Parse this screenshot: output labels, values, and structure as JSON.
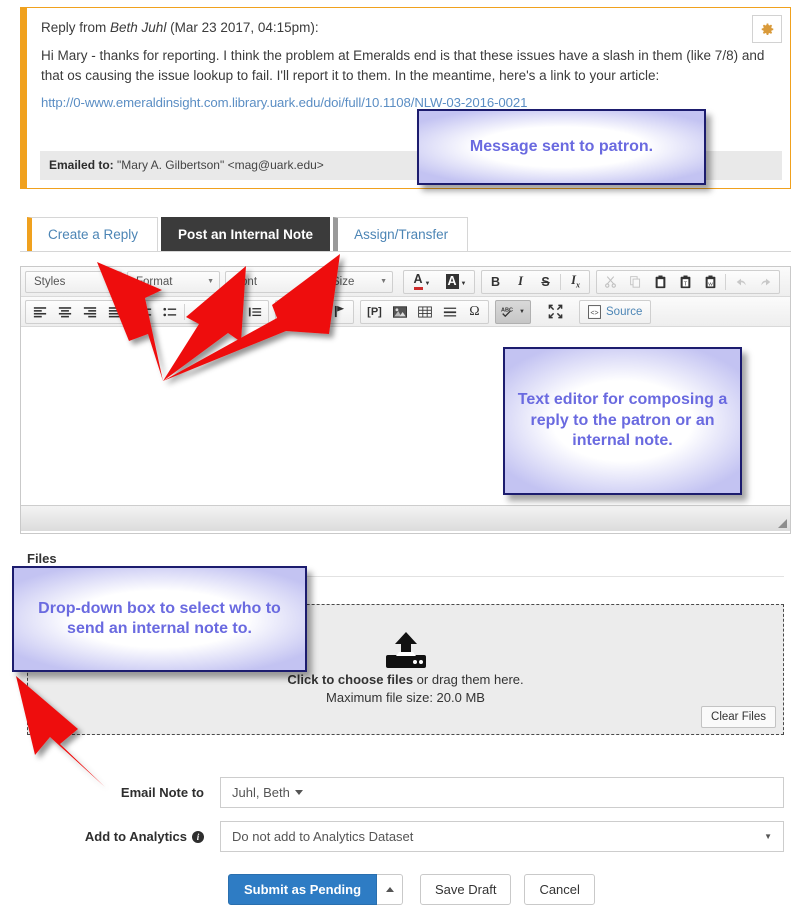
{
  "message": {
    "header_prefix": "Reply from ",
    "author": "Beth Juhl",
    "header_suffix": " (Mar 23 2017, 04:15pm):",
    "body": "Hi Mary - thanks for reporting.  I think the problem at Emeralds end is that these issues have a slash in them (like 7/8) and that os causing the issue lookup to fail.  I'll report it to them.  In the meantime, here's a link to your article:",
    "link": "http://0-www.emeraldinsight.com.library.uark.edu/doi/full/10.1108/NLW-03-2016-0021",
    "emailed_to_label": "Emailed to:",
    "emailed_to_value": " \"Mary A. Gilbertson\" <mag@uark.edu>",
    "gear_icon": "gear-icon"
  },
  "tabs": [
    {
      "label": "Create a Reply",
      "active": false,
      "accent": "#f0a11e"
    },
    {
      "label": "Post an Internal Note",
      "active": true,
      "accent": "#3b3b3b"
    },
    {
      "label": "Assign/Transfer",
      "active": false,
      "accent": "#9a9a9a"
    }
  ],
  "editor": {
    "combos": [
      {
        "label": "Styles",
        "name": "styles-dropdown"
      },
      {
        "label": "Format",
        "name": "format-dropdown"
      },
      {
        "label": "Font",
        "name": "font-dropdown"
      },
      {
        "label": "Size",
        "name": "size-dropdown"
      }
    ],
    "row1_icons": [
      "text-color-icon",
      "background-color-icon",
      "bold-icon",
      "italic-icon",
      "strikethrough-icon",
      "remove-format-icon",
      "cut-icon",
      "copy-icon",
      "paste-icon",
      "paste-text-icon",
      "paste-word-icon",
      "undo-icon",
      "redo-icon"
    ],
    "row2_icons": [
      "align-left-icon",
      "align-center-icon",
      "align-right-icon",
      "align-justify-icon",
      "numbered-list-icon",
      "bulleted-list-icon",
      "outdent-icon",
      "indent-icon",
      "blockquote-icon",
      "link-icon",
      "unlink-icon",
      "anchor-icon",
      "page-break-icon",
      "image-icon",
      "table-icon",
      "horizontal-rule-icon",
      "special-character-icon",
      "spellcheck-icon",
      "maximize-icon"
    ],
    "source_label": "Source",
    "content": ""
  },
  "files": {
    "section_label": "Files",
    "upload_icon": "upload-icon",
    "prompt_bold": "Click to choose files",
    "prompt_rest": " or drag them here.",
    "max_size": "Maximum file size: 20.0 MB",
    "clear_button": "Clear Files"
  },
  "form": {
    "email_note_label": "Email Note to",
    "email_note_value": "Juhl, Beth",
    "analytics_label": "Add to Analytics",
    "analytics_info_icon": "info-icon",
    "analytics_value": "Do not add to Analytics Dataset"
  },
  "actions": {
    "submit_label": "Submit as Pending",
    "submit_caret_icon": "caret-up-icon",
    "save_draft_label": "Save Draft",
    "cancel_label": "Cancel"
  },
  "callouts": {
    "message": "Message sent to patron.",
    "editor": "Text editor for composing a reply to the patron or an internal note.",
    "dropdown": "Drop-down box to select who to send an internal note to."
  },
  "colors": {
    "accent_orange": "#f0a11e",
    "callout_border": "#1c1c6e",
    "callout_text": "#6a6ae0",
    "arrow_red": "#ee1111",
    "primary_button": "#2e7cc4",
    "link_blue": "#5b8ec4"
  }
}
